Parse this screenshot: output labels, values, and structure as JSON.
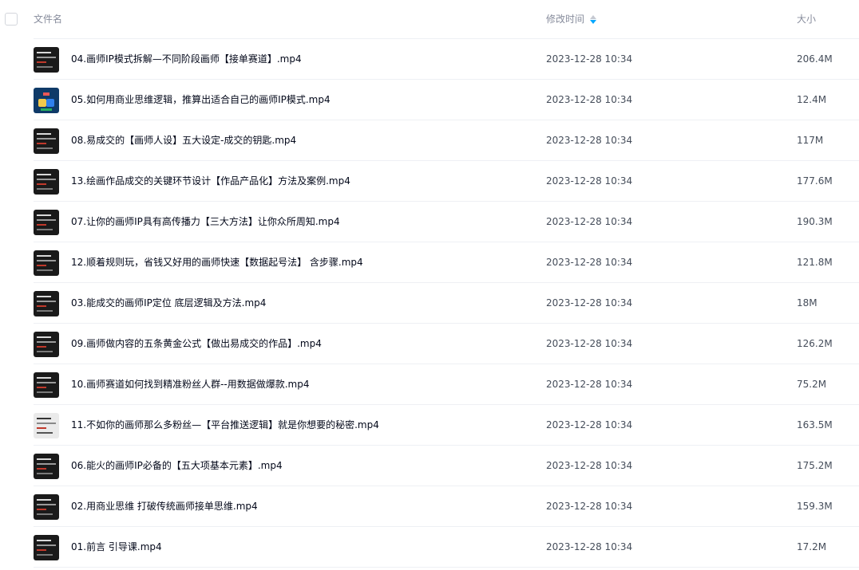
{
  "header": {
    "name_label": "文件名",
    "time_label": "修改时间",
    "size_label": "大小",
    "sort_icon": "sort-desc-icon"
  },
  "colors": {
    "accent": "#06a7ff",
    "header_text": "#878c9c",
    "divider": "#eef0f4"
  },
  "files": [
    {
      "name": "04.画师IP模式拆解—不同阶段画师【接单赛道】.mp4",
      "time": "2023-12-28 10:34",
      "size": "206.4M",
      "thumb": "dark"
    },
    {
      "name": "05.如何用商业思维逻辑，推算出适合自己的画师IP模式.mp4",
      "time": "2023-12-28 10:34",
      "size": "12.4M",
      "thumb": "colorful"
    },
    {
      "name": "08.易成交的【画师人设】五大设定-成交的钥匙.mp4",
      "time": "2023-12-28 10:34",
      "size": "117M",
      "thumb": "dark"
    },
    {
      "name": "13.绘画作品成交的关键环节设计【作品产品化】方法及案例.mp4",
      "time": "2023-12-28 10:34",
      "size": "177.6M",
      "thumb": "dark"
    },
    {
      "name": "07.让你的画师IP具有高传播力【三大方法】让你众所周知.mp4",
      "time": "2023-12-28 10:34",
      "size": "190.3M",
      "thumb": "dark"
    },
    {
      "name": "12.顺着规则玩，省钱又好用的画师快速【数据起号法】 含步骤.mp4",
      "time": "2023-12-28 10:34",
      "size": "121.8M",
      "thumb": "dark"
    },
    {
      "name": "03.能成交的画师IP定位 底层逻辑及方法.mp4",
      "time": "2023-12-28 10:34",
      "size": "18M",
      "thumb": "dark"
    },
    {
      "name": "09.画师做内容的五条黄金公式【做出易成交的作品】.mp4",
      "time": "2023-12-28 10:34",
      "size": "126.2M",
      "thumb": "dark"
    },
    {
      "name": "10.画师赛道如何找到精准粉丝人群--用数据做爆款.mp4",
      "time": "2023-12-28 10:34",
      "size": "75.2M",
      "thumb": "dark"
    },
    {
      "name": "11.不如你的画师那么多粉丝—【平台推送逻辑】就是你想要的秘密.mp4",
      "time": "2023-12-28 10:34",
      "size": "163.5M",
      "thumb": "light"
    },
    {
      "name": "06.能火的画师IP必备的【五大项基本元素】.mp4",
      "time": "2023-12-28 10:34",
      "size": "175.2M",
      "thumb": "dark"
    },
    {
      "name": "02.用商业思维 打破传统画师接单思维.mp4",
      "time": "2023-12-28 10:34",
      "size": "159.3M",
      "thumb": "dark"
    },
    {
      "name": "01.前言 引导课.mp4",
      "time": "2023-12-28 10:34",
      "size": "17.2M",
      "thumb": "dark"
    }
  ]
}
